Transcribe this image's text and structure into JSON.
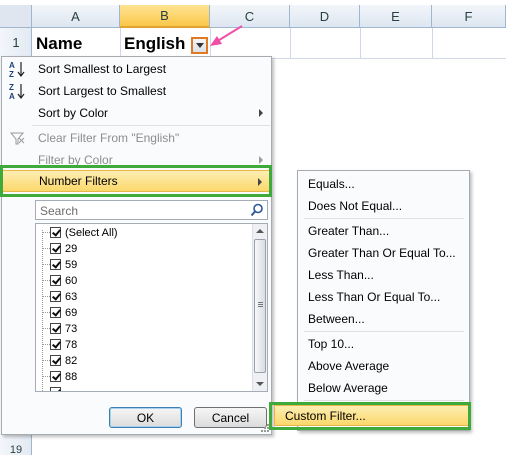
{
  "sheet": {
    "columns": [
      "A",
      "B",
      "C",
      "D",
      "E",
      "F"
    ],
    "rows": [
      "1",
      "19"
    ],
    "cells": {
      "a1": "Name",
      "b1": "English"
    }
  },
  "filter_menu": {
    "sort_asc": "Sort Smallest to Largest",
    "sort_desc": "Sort Largest to Smallest",
    "sort_color": "Sort by Color",
    "clear_filter": "Clear Filter From \"English\"",
    "filter_color": "Filter by Color",
    "number_filters": "Number Filters",
    "search_placeholder": "Search",
    "values": [
      "(Select All)",
      "29",
      "59",
      "60",
      "63",
      "69",
      "73",
      "78",
      "82",
      "88"
    ],
    "ok": "OK",
    "cancel": "Cancel"
  },
  "number_filters_menu": {
    "items": [
      "Equals...",
      "Does Not Equal...",
      "Greater Than...",
      "Greater Than Or Equal To...",
      "Less Than...",
      "Less Than Or Equal To...",
      "Between...",
      "Top 10...",
      "Above Average",
      "Below Average",
      "Custom Filter..."
    ]
  },
  "colors": {
    "highlight_box": "#3eaa3a",
    "arrow": "#ef4fa6",
    "dropdown_button_border": "#e07a22",
    "selected_column": "#f9c74a"
  }
}
